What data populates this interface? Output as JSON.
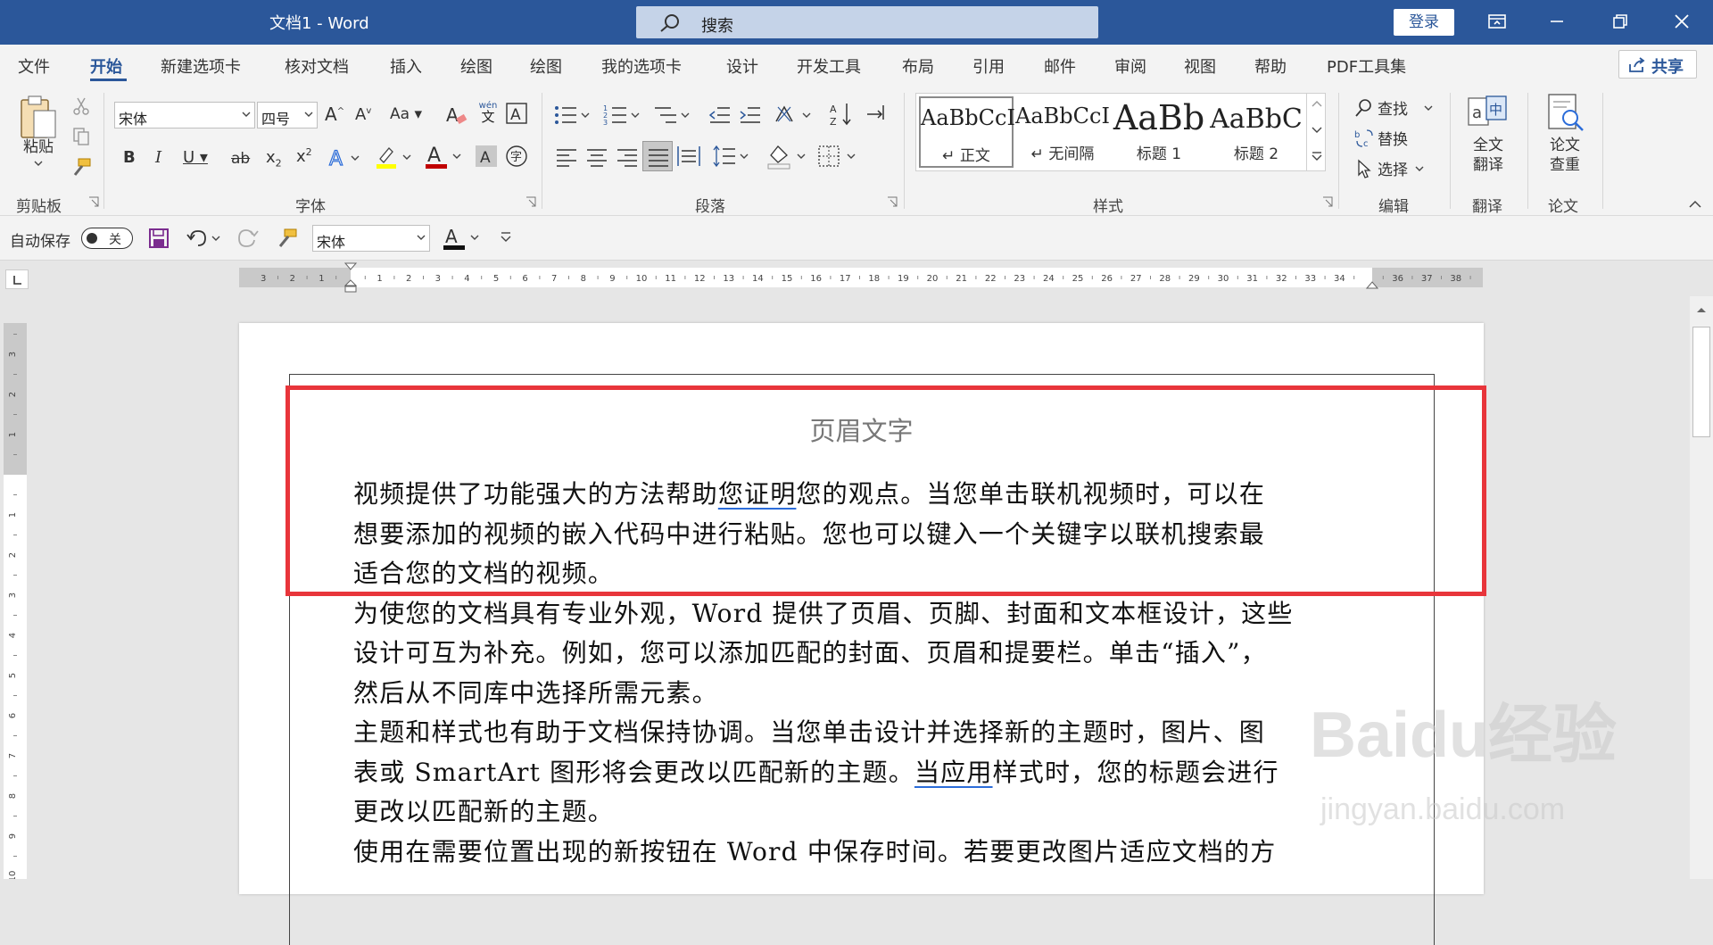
{
  "window": {
    "title": "文档1  -  Word",
    "search_placeholder": "搜索",
    "login_label": "登录"
  },
  "tabs": [
    {
      "label": "文件"
    },
    {
      "label": "开始",
      "active": true
    },
    {
      "label": "新建选项卡"
    },
    {
      "label": "核对文档"
    },
    {
      "label": "插入"
    },
    {
      "label": "绘图"
    },
    {
      "label": "绘图"
    },
    {
      "label": "我的选项卡"
    },
    {
      "label": "设计"
    },
    {
      "label": "开发工具"
    },
    {
      "label": "布局"
    },
    {
      "label": "引用"
    },
    {
      "label": "邮件"
    },
    {
      "label": "审阅"
    },
    {
      "label": "视图"
    },
    {
      "label": "帮助"
    },
    {
      "label": "PDF工具集"
    }
  ],
  "share_label": "共享",
  "ribbon": {
    "clipboard": {
      "paste_label": "粘贴",
      "group_label": "剪贴板"
    },
    "font": {
      "font_name": "宋体",
      "font_size": "四号",
      "group_label": "字体",
      "change_case": "Aa",
      "phonetic_top": "wén",
      "phonetic_bottom": "文"
    },
    "paragraph": {
      "group_label": "段落"
    },
    "styles": {
      "group_label": "样式",
      "items": [
        {
          "sample": "AaBbCcI",
          "name": "↵ 正文"
        },
        {
          "sample": "AaBbCcI",
          "name": "↵ 无间隔"
        },
        {
          "sample": "AaBb",
          "name": "标题 1"
        },
        {
          "sample": "AaBbC",
          "name": "标题 2"
        }
      ]
    },
    "editing": {
      "find": "查找",
      "replace": "替换",
      "select": "选择",
      "group_label": "编辑"
    },
    "translate": {
      "label_line1": "全文",
      "label_line2": "翻译",
      "group_label": "翻译"
    },
    "paper": {
      "label_line1": "论文",
      "label_line2": "查重",
      "group_label": "论文"
    }
  },
  "qat": {
    "autosave_label": "自动保存",
    "toggle_state": "关",
    "font_name": "宋体"
  },
  "document": {
    "header_text": "页眉文字",
    "paragraphs": [
      {
        "lines": [
          {
            "pre": "视频提供了功能强大的方法帮助",
            "mark": "您证明",
            "post": "您的观点。当您单击联机视频时，可以在"
          },
          {
            "pre": "想要添加的视频的嵌入代码中进行粘贴。您也可以键入一个关键字以联机搜索最",
            "mark": "",
            "post": ""
          },
          {
            "pre": "适合您的文档的视频。",
            "mark": "",
            "post": ""
          }
        ]
      },
      {
        "lines": [
          {
            "pre": "为使您的文档具有专业外观，Word 提供了页眉、页脚、封面和文本框设计，这些",
            "mark": "",
            "post": ""
          },
          {
            "pre": "设计可互为补充。例如，您可以添加匹配的封面、页眉和提要栏。单击“插入”，",
            "mark": "",
            "post": ""
          },
          {
            "pre": "然后从不同库中选择所需元素。",
            "mark": "",
            "post": ""
          }
        ]
      },
      {
        "lines": [
          {
            "pre": "主题和样式也有助于文档保持协调。当您单击设计并选择新的主题时，图片、图",
            "mark": "",
            "post": ""
          },
          {
            "pre": "表或 SmartArt 图形将会更改以匹配新的主题。",
            "mark": "当应用",
            "post": "样式时，您的标题会进行"
          },
          {
            "pre": "更改以匹配新的主题。",
            "mark": "",
            "post": ""
          }
        ]
      },
      {
        "lines": [
          {
            "pre": "使用在需要位置出现的新按钮在 Word 中保存时间。若要更改图片适应文档的方",
            "mark": "",
            "post": ""
          }
        ]
      }
    ]
  },
  "ruler": {
    "h_left_labels": [
      "3",
      "2",
      "1"
    ],
    "h_labels": [
      "1",
      "2",
      "3",
      "4",
      "5",
      "6",
      "7",
      "8",
      "9",
      "10",
      "11",
      "12",
      "13",
      "14",
      "15",
      "16",
      "17",
      "18",
      "19",
      "20",
      "21",
      "22",
      "23",
      "24",
      "25",
      "26",
      "27",
      "28",
      "29",
      "30",
      "31",
      "32",
      "33",
      "34"
    ],
    "h_right_labels": [
      "36",
      "37",
      "38"
    ],
    "v_top_labels": [
      "3",
      "2",
      "1"
    ],
    "v_labels": [
      "1",
      "2",
      "3",
      "4",
      "5",
      "6",
      "7",
      "8",
      "9",
      "10"
    ]
  },
  "watermark": {
    "text": "Baidu经验",
    "url": "jingyan.baidu.com"
  },
  "colors": {
    "title_bar": "#2b579a",
    "highlight_box": "#e8353b",
    "accent": "#2b579a"
  }
}
